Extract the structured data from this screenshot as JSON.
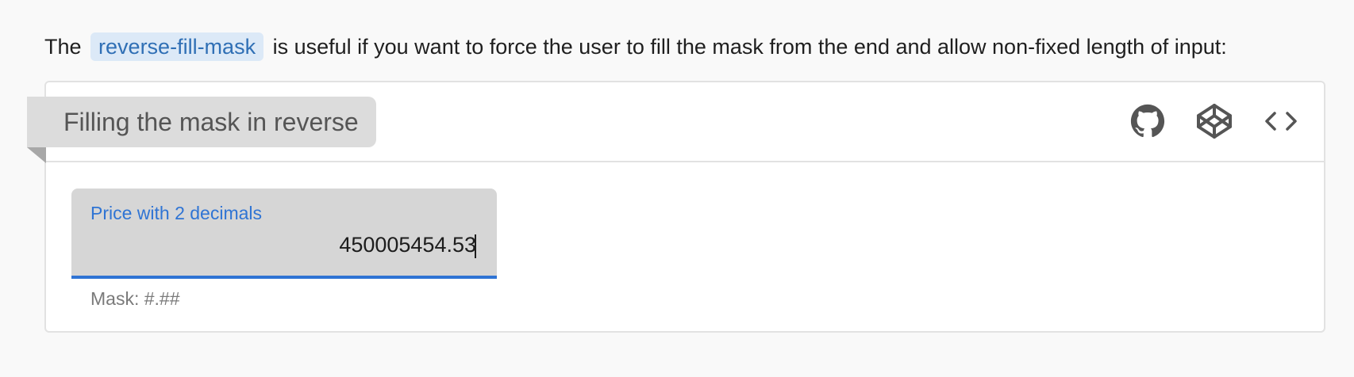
{
  "intro": {
    "prefix": "The",
    "code": "reverse-fill-mask",
    "suffix": "is useful if you want to force the user to fill the mask from the end and allow non-fixed length of input:"
  },
  "example": {
    "title": "Filling the mask in reverse",
    "toolbar": [
      {
        "icon": "github-icon"
      },
      {
        "icon": "codepen-icon"
      },
      {
        "icon": "code-icon"
      }
    ],
    "field": {
      "label": "Price with 2 decimals",
      "value": "450005454.53",
      "hint": "Mask: #.##",
      "accent_color": "#2f74d4"
    }
  },
  "colors": {
    "code_bg": "#dce9f7",
    "code_text": "#2f6fb5",
    "ribbon_bg": "#dcdcdc",
    "field_bg": "#d6d6d6"
  }
}
